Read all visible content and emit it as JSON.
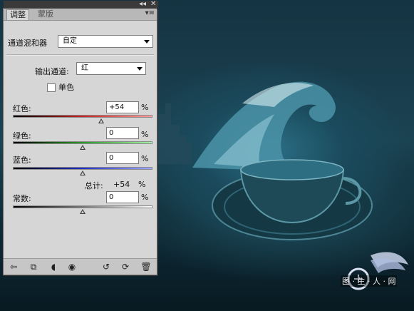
{
  "colors": {
    "panel_bg": "#d6d6d6",
    "accent_red": "#cc2020",
    "accent_green": "#2a9a2a",
    "accent_blue": "#2030c8"
  },
  "window_controls": {
    "collapse_icon": "double-chevron-left-icon",
    "close_icon": "close-icon"
  },
  "tabs": [
    {
      "label": "调整",
      "active": true
    },
    {
      "label": "蒙版",
      "active": false
    }
  ],
  "mixer": {
    "label": "通道混和器",
    "preset_value": "自定"
  },
  "output_channel": {
    "label": "输出通道:",
    "value": "红"
  },
  "monochrome": {
    "label": "单色",
    "checked": false
  },
  "sliders": [
    {
      "key": "red",
      "label": "红色:",
      "value": "+54",
      "unit": "%",
      "fraction": 0.635
    },
    {
      "key": "green",
      "label": "绿色:",
      "value": "0",
      "unit": "%",
      "fraction": 0.5
    },
    {
      "key": "blue",
      "label": "蓝色:",
      "value": "0",
      "unit": "%",
      "fraction": 0.5
    }
  ],
  "total": {
    "label": "总计:",
    "value": "+54",
    "unit": "%"
  },
  "constant": {
    "label": "常数:",
    "value": "0",
    "unit": "%",
    "fraction": 0.5
  },
  "footer_icons": [
    "back-arrow-icon",
    "expand-view-icon",
    "clip-layer-icon",
    "visibility-eye-icon",
    "reset-previous-icon",
    "reset-icon",
    "trash-icon"
  ],
  "watermark": {
    "text": "图 · 生 · 人 · 网"
  }
}
